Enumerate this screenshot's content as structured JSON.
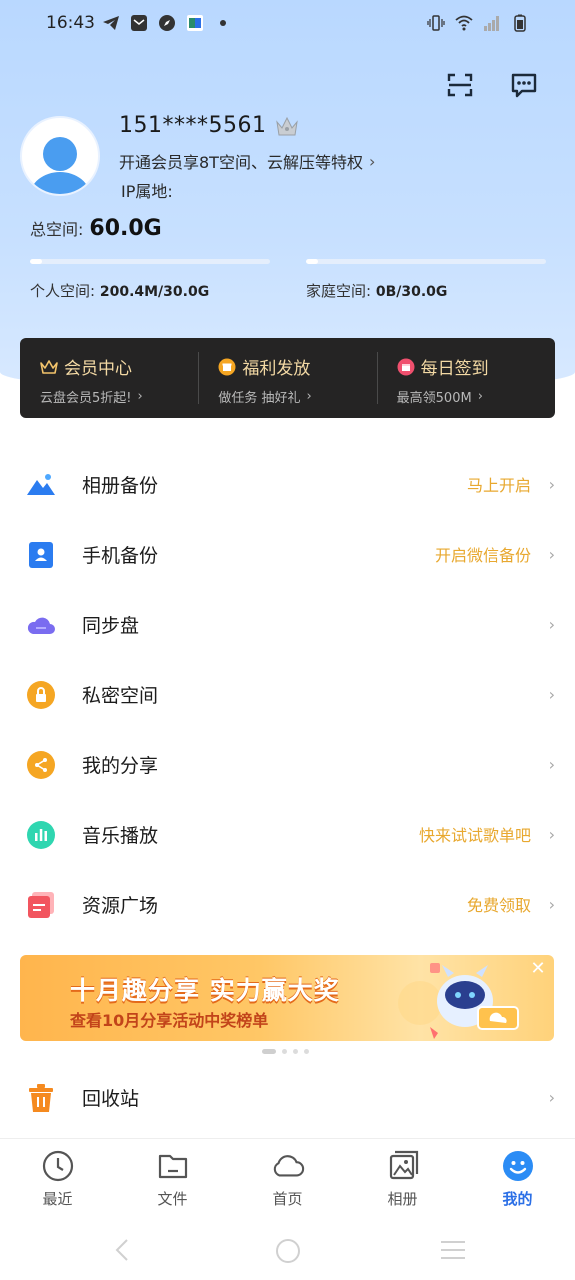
{
  "status": {
    "time": "16:43"
  },
  "user": {
    "phone": "151****5561",
    "vip_promo": "开通会员享8T空间、云解压等特权",
    "ip_label": "IP属地:"
  },
  "storage": {
    "total_label": "总空间:",
    "total_value": "60.0G",
    "personal_label": "个人空间:",
    "personal_value": "200.4M/30.0G",
    "personal_fraction": 0.0065,
    "family_label": "家庭空间:",
    "family_value": "0B/30.0G",
    "family_fraction": 0
  },
  "vip_card": [
    {
      "title": "会员中心",
      "sub": "云盘会员5折起!",
      "icon": "crown-icon"
    },
    {
      "title": "福利发放",
      "sub": "做任务 抽好礼",
      "icon": "gift-icon"
    },
    {
      "title": "每日签到",
      "sub": "最高领500M",
      "icon": "calendar-icon"
    }
  ],
  "menu": [
    {
      "label": "相册备份",
      "hint": "马上开启",
      "icon": "album-backup-icon"
    },
    {
      "label": "手机备份",
      "hint": "开启微信备份",
      "icon": "phone-backup-icon"
    },
    {
      "label": "同步盘",
      "hint": "",
      "icon": "sync-cloud-icon"
    },
    {
      "label": "私密空间",
      "hint": "",
      "icon": "lock-icon"
    },
    {
      "label": "我的分享",
      "hint": "",
      "icon": "share-icon"
    },
    {
      "label": "音乐播放",
      "hint": "快来试试歌单吧",
      "icon": "music-icon"
    },
    {
      "label": "资源广场",
      "hint": "免费领取",
      "icon": "resource-icon"
    }
  ],
  "banner": {
    "title": "十月趣分享 实力赢大奖",
    "subtitle": "查看10月分享活动中奖榜单"
  },
  "recycle": {
    "label": "回收站",
    "icon": "trash-icon"
  },
  "tabs": [
    {
      "label": "最近",
      "icon": "clock-icon"
    },
    {
      "label": "文件",
      "icon": "folder-icon"
    },
    {
      "label": "首页",
      "icon": "cloud-icon"
    },
    {
      "label": "相册",
      "icon": "photo-icon"
    },
    {
      "label": "我的",
      "icon": "profile-icon",
      "active": true
    }
  ],
  "colors": {
    "accent": "#2b6fe6",
    "hint": "#e8a82f",
    "vip_gold": "#f3d9a4",
    "hero_bg": "#c7e0ff"
  }
}
